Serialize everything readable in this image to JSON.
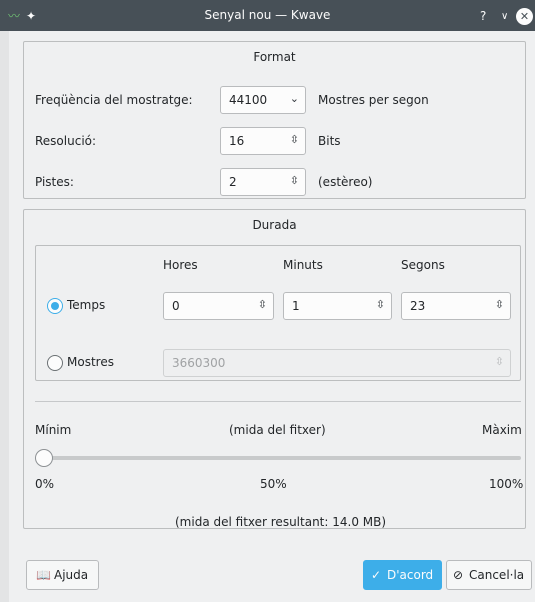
{
  "window": {
    "title": "Senyal nou — Kwave",
    "app_icon": "kwave-waveform-icon",
    "pin_icon": "pin-icon",
    "help_glyph": "?",
    "minimize_glyph": "∨",
    "close_glyph": "✕"
  },
  "format": {
    "title": "Format",
    "sample_rate": {
      "label": "Freqüència del mostratge:",
      "value": "44100",
      "unit": "Mostres per segon"
    },
    "resolution": {
      "label": "Resolució:",
      "value": "16",
      "unit": "Bits"
    },
    "tracks": {
      "label": "Pistes:",
      "value": "2",
      "unit": "(estèreo)"
    }
  },
  "duration": {
    "title": "Durada",
    "headers": {
      "hours": "Hores",
      "minutes": "Minuts",
      "seconds": "Segons"
    },
    "time_option": {
      "label": "Temps",
      "checked": true,
      "hours": "0",
      "minutes": "1",
      "seconds": "23"
    },
    "samples_option": {
      "label": "Mostres",
      "checked": false,
      "value": "3660300"
    },
    "slider": {
      "min_label": "Mínim",
      "mid_label": "(mida del fitxer)",
      "max_label": "Màxim",
      "tick_0": "0%",
      "tick_50": "50%",
      "tick_100": "100%",
      "value_percent": 0
    }
  },
  "result_text": "(mida del fitxer resultant: 14.0 MB)",
  "buttons": {
    "help": {
      "label": "Ajuda",
      "icon": "help-book-icon"
    },
    "ok": {
      "label": "D'acord",
      "icon": "checkmark-icon"
    },
    "cancel": {
      "label": "Cancel·la",
      "icon": "cancel-circle-icon"
    }
  },
  "colors": {
    "accent": "#3daee9",
    "titlebar": "#475057",
    "background": "#eff0f1"
  }
}
